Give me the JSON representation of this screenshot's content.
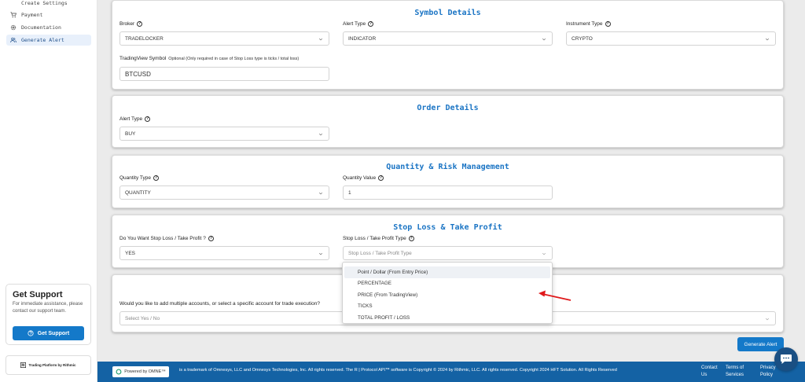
{
  "sidebar": {
    "items": [
      {
        "label": "Create Settings",
        "icon": "settings-icon"
      },
      {
        "label": "Payment",
        "icon": "cart-icon"
      },
      {
        "label": "Documentation",
        "icon": "settings-gear-icon"
      },
      {
        "label": "Generate Alert",
        "icon": "users-icon"
      }
    ],
    "support": {
      "title": "Get Support",
      "text": "For immediate assistance, please contact our support team.",
      "button": "Get Support"
    },
    "badge": "Trading Platform by Rithmic"
  },
  "symbol_details": {
    "title": "Symbol Details",
    "broker_label": "Broker",
    "broker_value": "TRADELOCKER",
    "alert_type_label": "Alert Type",
    "alert_type_value": "INDICATOR",
    "instrument_type_label": "Instrument Type",
    "instrument_type_value": "CRYPTO",
    "tv_symbol_label": "TradingView Symbol",
    "tv_symbol_note": "Optional (Only required in case of Stop Loss type is ticks / total loss)",
    "tv_symbol_value": "BTCUSD"
  },
  "order_details": {
    "title": "Order Details",
    "alert_type_label": "Alert Type",
    "alert_type_value": "BUY"
  },
  "quantity": {
    "title": "Quantity & Risk Management",
    "type_label": "Quantity Type",
    "type_value": "QUANTITY",
    "value_label": "Quantity Value",
    "value": "1"
  },
  "stoploss": {
    "title": "Stop Loss & Take Profit",
    "want_label": "Do You Want Stop Loss / Take Profit ?",
    "want_value": "YES",
    "type_label": "Stop Loss / Take Profit Type",
    "type_placeholder": "Stop Loss / Take Profit Type",
    "options": [
      "Point / Dollar (From Entry Price)",
      "PERCENTAGE",
      "PRICE (From TradingView)",
      "TICKS",
      "TOTAL PROFIT / LOSS"
    ]
  },
  "accounts": {
    "question": "Would you like to add multiple accounts, or select a specific account for trade execution?",
    "placeholder": "Select Yes / No"
  },
  "generate_button": "Generate Alert",
  "footer": {
    "powered_by": "Powered by OMNE™",
    "text": "is a trademark of Omnesys, LLC and Omnesys Technologies, Inc. All rights reserved. The R | Protocol API™ software is Copyright © 2024 by Rithmic, LLC. All rights reserved. Copyright 2024 HFT Solution. All Rights Reserved",
    "contact": "Contact Us",
    "terms": "Terms of Services",
    "privacy": "Privacy Policy"
  },
  "colors": {
    "accent": "#1479c9",
    "title": "#1a74c4",
    "footer": "#1462a4",
    "arrow": "#e0191b"
  }
}
